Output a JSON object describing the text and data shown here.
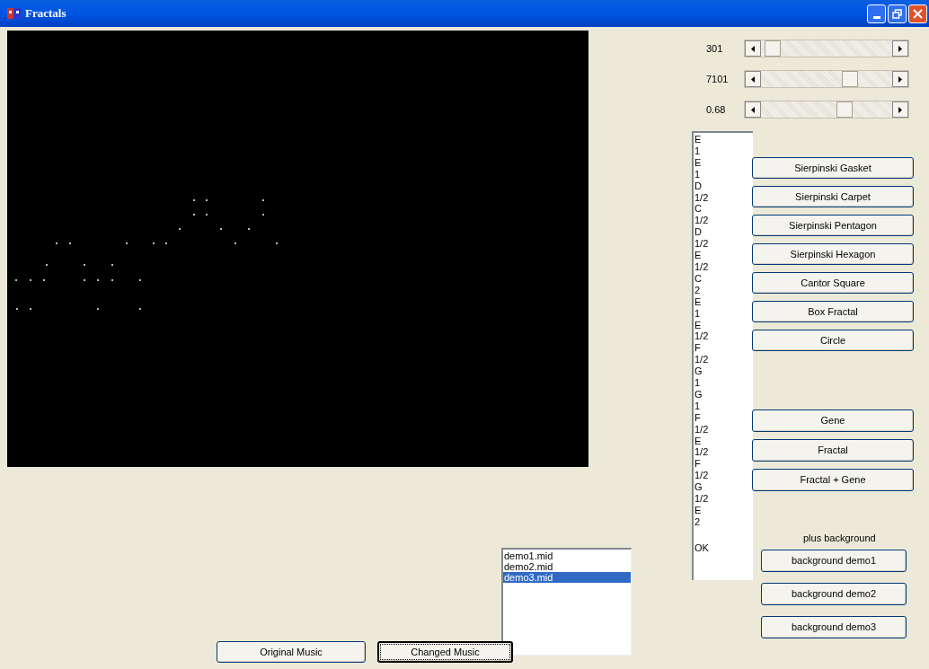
{
  "window": {
    "title": "Fractals"
  },
  "sliders": [
    {
      "reading": "301",
      "level": 0.03
    },
    {
      "reading": "7101",
      "level": 0.7
    },
    {
      "reading": "0.68",
      "level": 0.66
    }
  ],
  "notes": {
    "lines": [
      "E",
      "1",
      "E",
      "1",
      "D",
      "1/2",
      "C",
      "1/2",
      "D",
      "1/2",
      "E",
      "1/2",
      "C",
      "2",
      "E",
      "1",
      "E",
      "1/2",
      "F",
      "1/2",
      "G",
      "1",
      "G",
      "1",
      "F",
      "1/2",
      "E",
      "1/2",
      "F",
      "1/2",
      "G",
      "1/2",
      "E",
      "2"
    ],
    "status": "OK"
  },
  "fractal_buttons": [
    "Sierpinski Gasket",
    "Sierpinski Carpet",
    "Sierpinski Pentagon",
    "Sierpinski Hexagon",
    "Cantor Square",
    "Box Fractal",
    "Circle"
  ],
  "mode_buttons": [
    "Gene",
    "Fractal",
    "Fractal + Gene"
  ],
  "background_label": "plus background",
  "background_buttons": [
    "background demo1",
    "background demo2",
    "background demo3"
  ],
  "midi_files": [
    {
      "name": "demo1.mid",
      "selected": false
    },
    {
      "name": "demo2.mid",
      "selected": false
    },
    {
      "name": "demo3.mid",
      "selected": true
    }
  ],
  "music_buttons": [
    {
      "label": "Original Music",
      "focused": false
    },
    {
      "label": "Changed Music",
      "focused": true
    }
  ]
}
